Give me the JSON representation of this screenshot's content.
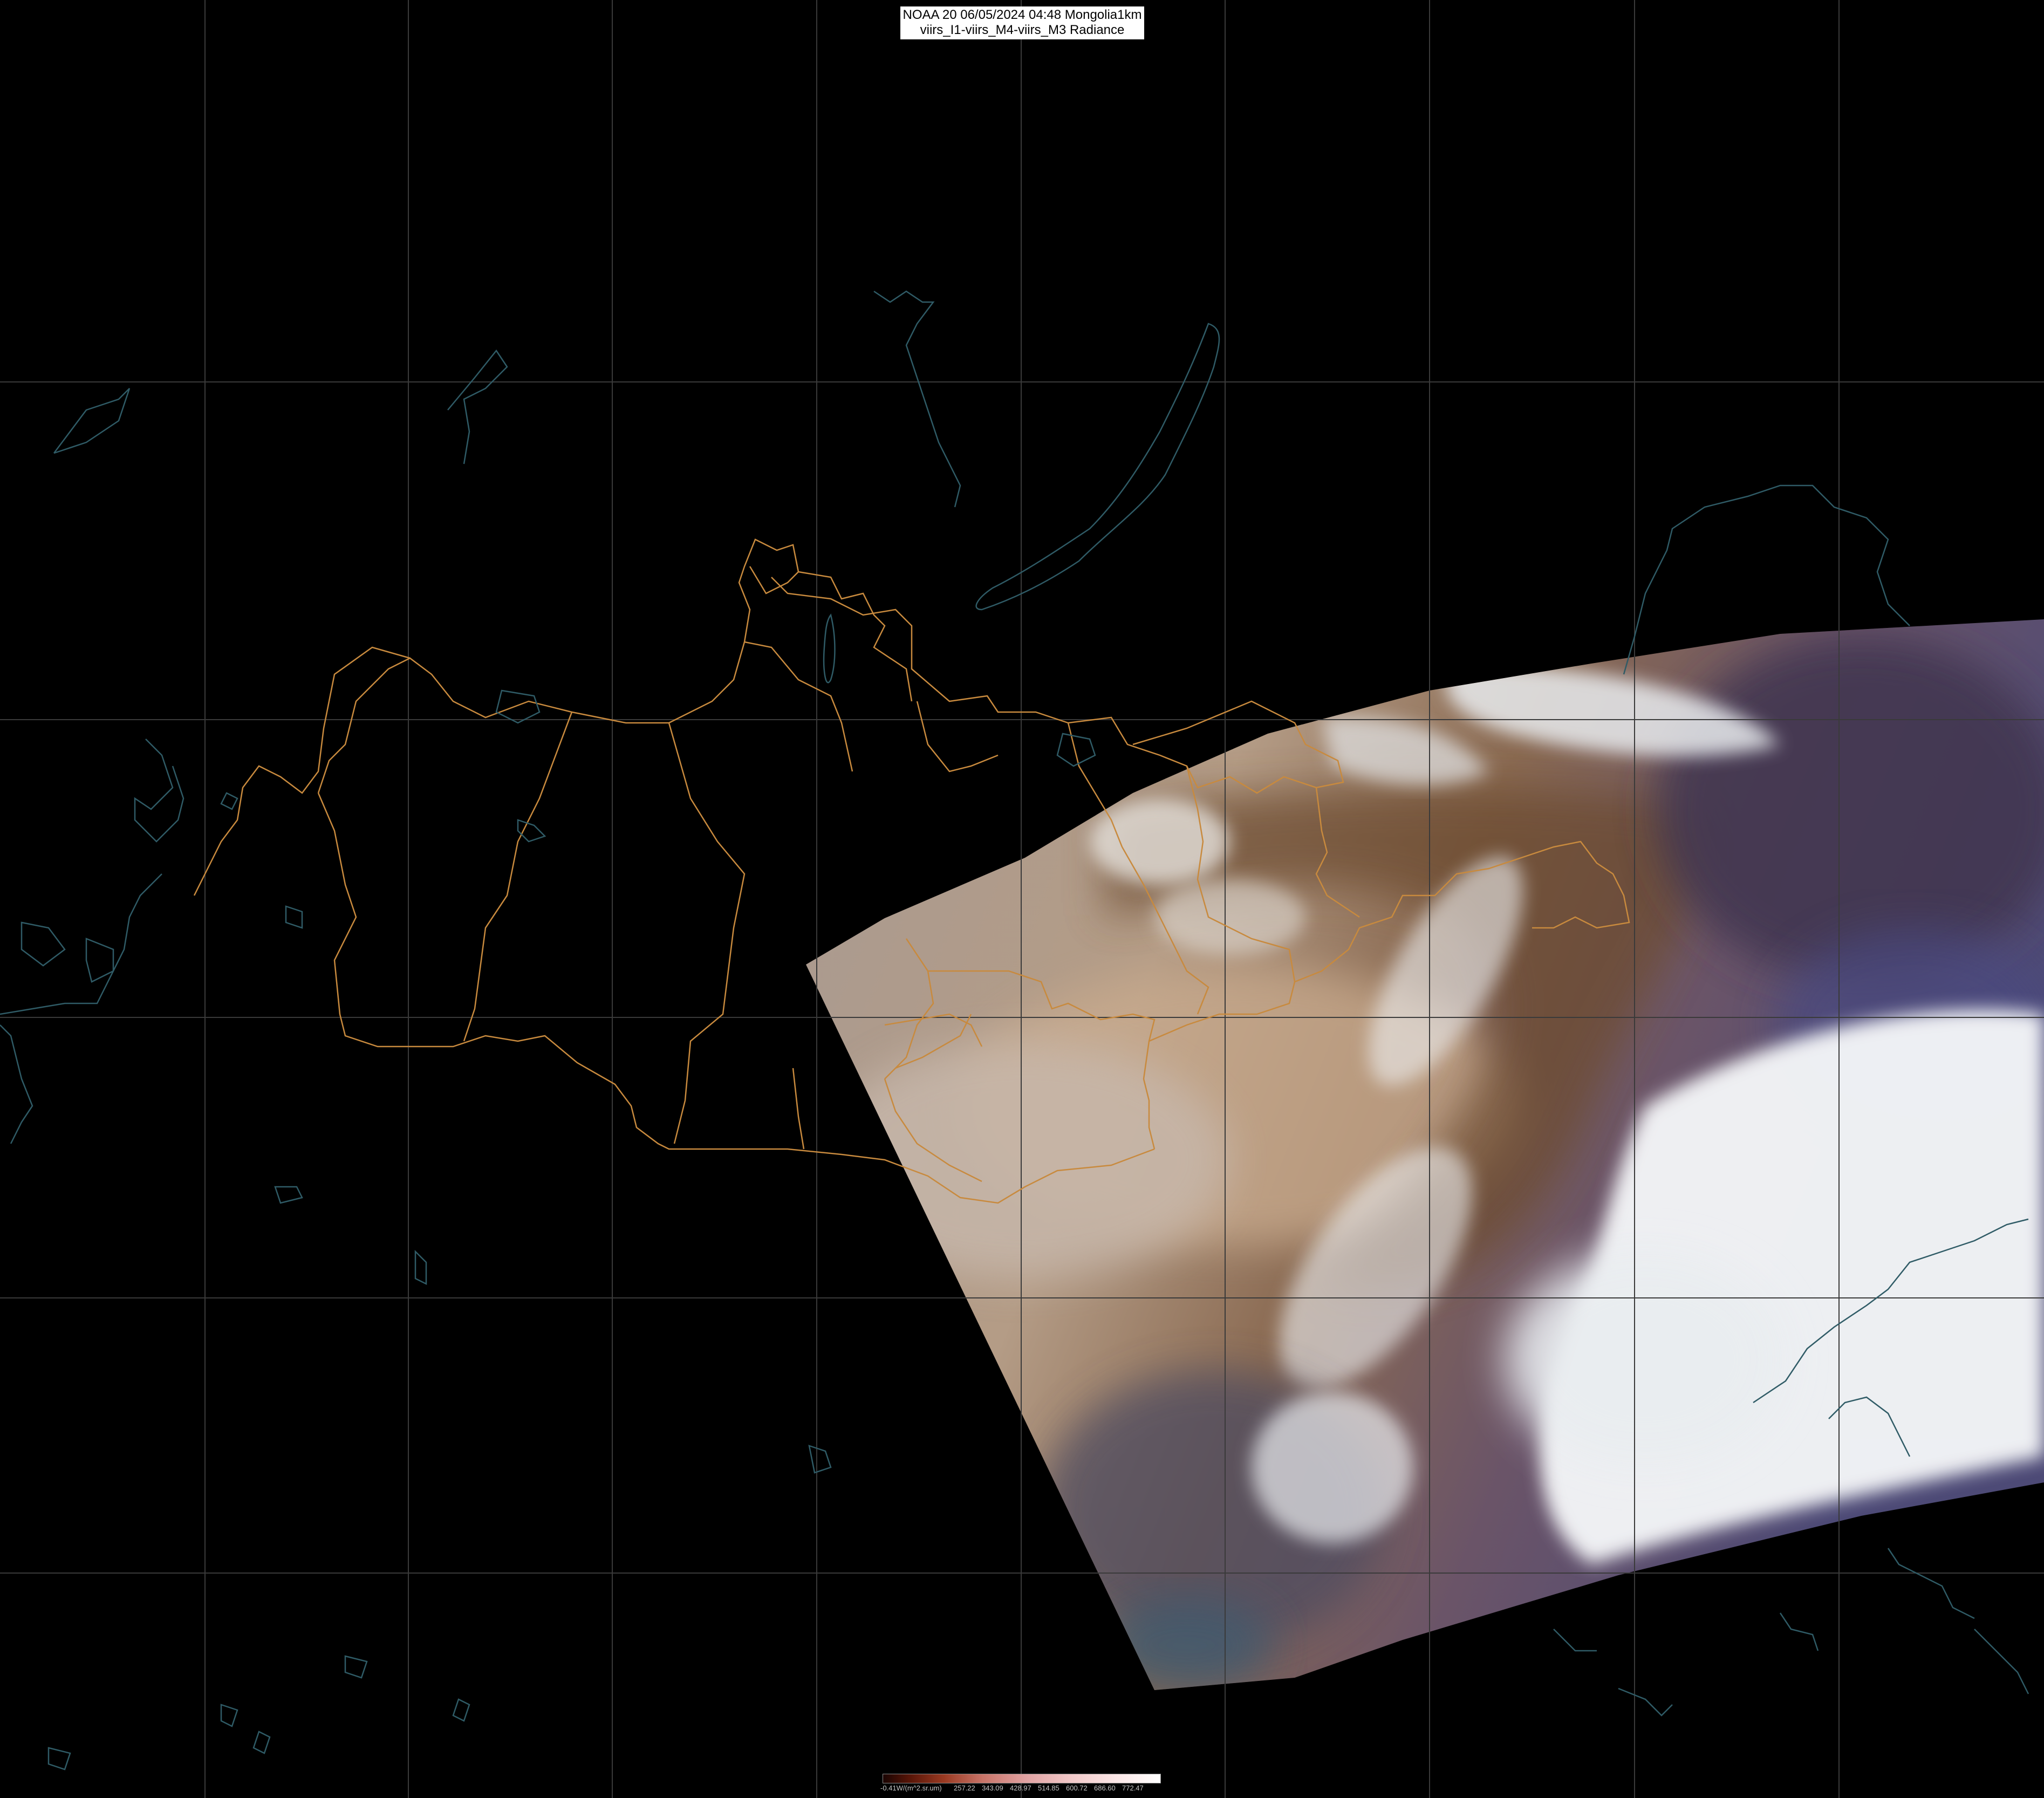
{
  "header": {
    "title_line1": "NOAA 20 06/05/2024 04:48 Mongolia1km",
    "title_line2": "viirs_I1-viirs_M4-viirs_M3 Radiance"
  },
  "colorbar": {
    "unit_and_min": "-0.41W/(m^2.sr.um)",
    "ticks": [
      "257.22",
      "343.09",
      "428.97",
      "514.85",
      "600.72",
      "686.60",
      "772.47"
    ]
  },
  "colors": {
    "background": "#000000",
    "graticule": "#3a3a3a",
    "admin_borders": "#c88a3e",
    "coastlines_lakes": "#2f5b66",
    "cloud": "#f4f6f8"
  },
  "layers": [
    "graticule",
    "satellite-swath",
    "admin-borders",
    "coastlines-and-lakes"
  ]
}
